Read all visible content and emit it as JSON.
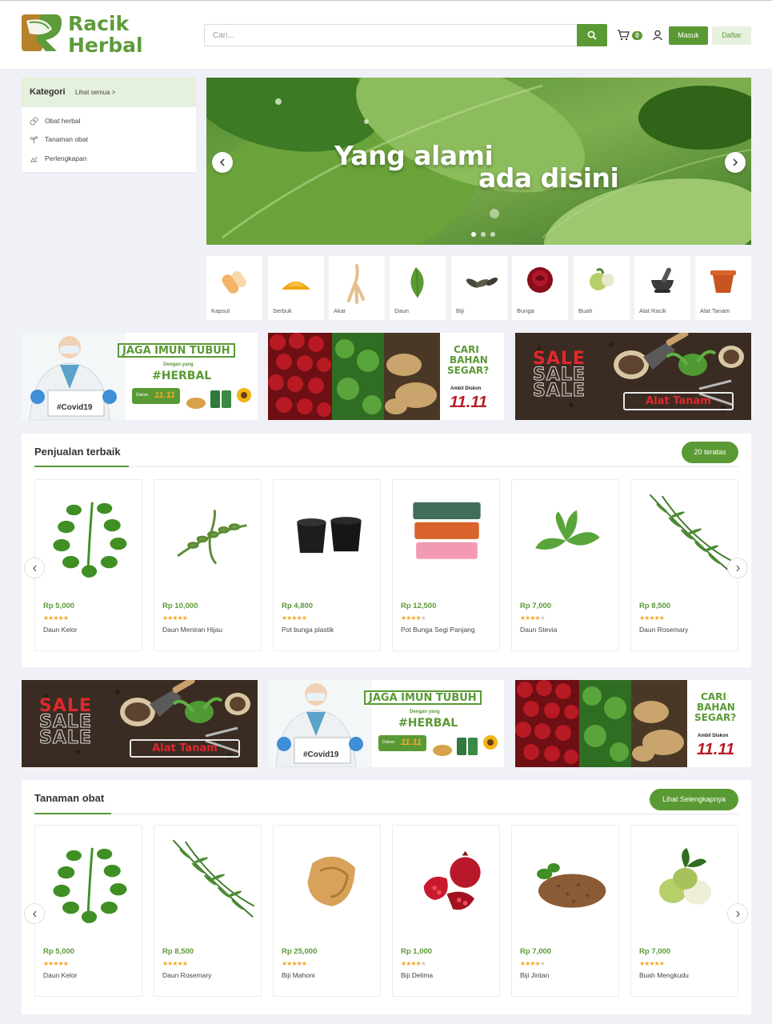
{
  "header": {
    "logo_line1": "Racik",
    "logo_line2": "Herbal",
    "search_placeholder": "Cari...",
    "cart_count": "0",
    "login_label": "Masuk",
    "register_label": "Daftar"
  },
  "colors": {
    "brand": "#5a9a35",
    "brand_light": "#e7f1df",
    "logo_brown": "#b5812a",
    "star": "#f5a623"
  },
  "categories": {
    "title": "Kategori",
    "see_all": "Lihat semua >",
    "items": [
      {
        "label": "Obat herbal",
        "icon": "pills-icon"
      },
      {
        "label": "Tanaman obat",
        "icon": "plant-icon"
      },
      {
        "label": "Perlengkapan",
        "icon": "tools-icon"
      }
    ]
  },
  "hero": {
    "line1": "Yang alami",
    "line2": "ada disini",
    "slides": 3
  },
  "tiles": [
    {
      "label": "Kapsul",
      "icon": "capsule-icon"
    },
    {
      "label": "Serbuk",
      "icon": "powder-icon"
    },
    {
      "label": "Akar",
      "icon": "root-icon"
    },
    {
      "label": "Daun",
      "icon": "leaf-icon"
    },
    {
      "label": "Biji",
      "icon": "seed-icon"
    },
    {
      "label": "Bunga",
      "icon": "rose-icon"
    },
    {
      "label": "Buah",
      "icon": "fruit-icon"
    },
    {
      "label": "Alat Racik",
      "icon": "mortar-icon"
    },
    {
      "label": "Alat Tanam",
      "icon": "pot-icon"
    }
  ],
  "promos": {
    "imun": {
      "title": "JAGA IMUN TUBUH",
      "sub": "Dengan yang",
      "tag": "#HERBAL",
      "diskon": "Diskon",
      "date": "11.11",
      "card": "#Covid19"
    },
    "bahan": {
      "line1": "CARI",
      "line2": "BAHAN",
      "line3": "SEGAR?",
      "diskon": "Ambil Diskon",
      "date": "11.11"
    },
    "sale": {
      "word": "SALE",
      "cta": "Alat Tanam"
    }
  },
  "best_sellers": {
    "title": "Penjualan terbaik",
    "button": "20 teratas",
    "products": [
      {
        "price": "Rp 5,000",
        "name": "Daun Kelor",
        "rating": 5,
        "icon": "moringa-leaf-icon"
      },
      {
        "price": "Rp 10,000",
        "name": "Daun Meniran Hijau",
        "rating": 5,
        "icon": "meniran-leaf-icon"
      },
      {
        "price": "Rp 4,800",
        "name": "Pot bunga plastik",
        "rating": 5,
        "icon": "plastic-pot-icon"
      },
      {
        "price": "Rp 12,500",
        "name": "Pot Bunga Segi Panjang",
        "rating": 4,
        "icon": "planter-box-icon"
      },
      {
        "price": "Rp 7,000",
        "name": "Daun Stevia",
        "rating": 4,
        "icon": "stevia-leaf-icon"
      },
      {
        "price": "Rp 8,500",
        "name": "Daun Rosemary",
        "rating": 5,
        "icon": "rosemary-icon"
      }
    ]
  },
  "medicinal_plants": {
    "title": "Tanaman obat",
    "button": "Lihat Selengkapnya",
    "products": [
      {
        "price": "Rp 5,000",
        "name": "Daun Kelor",
        "rating": 5,
        "icon": "moringa-leaf-icon"
      },
      {
        "price": "Rp 8,500",
        "name": "Daun Rosemary",
        "rating": 5,
        "icon": "rosemary-icon"
      },
      {
        "price": "Rp 25,000",
        "name": "Biji Mahoni",
        "rating": 5,
        "icon": "mahogany-seed-icon"
      },
      {
        "price": "Rp 1,000",
        "name": "Biji Delima",
        "rating": 4,
        "icon": "pomegranate-icon"
      },
      {
        "price": "Rp 7,000",
        "name": "Biji Jintan",
        "rating": 4,
        "icon": "cumin-seed-icon"
      },
      {
        "price": "Rp 7,000",
        "name": "Buah Mengkudu",
        "rating": 5,
        "icon": "noni-fruit-icon"
      }
    ]
  }
}
